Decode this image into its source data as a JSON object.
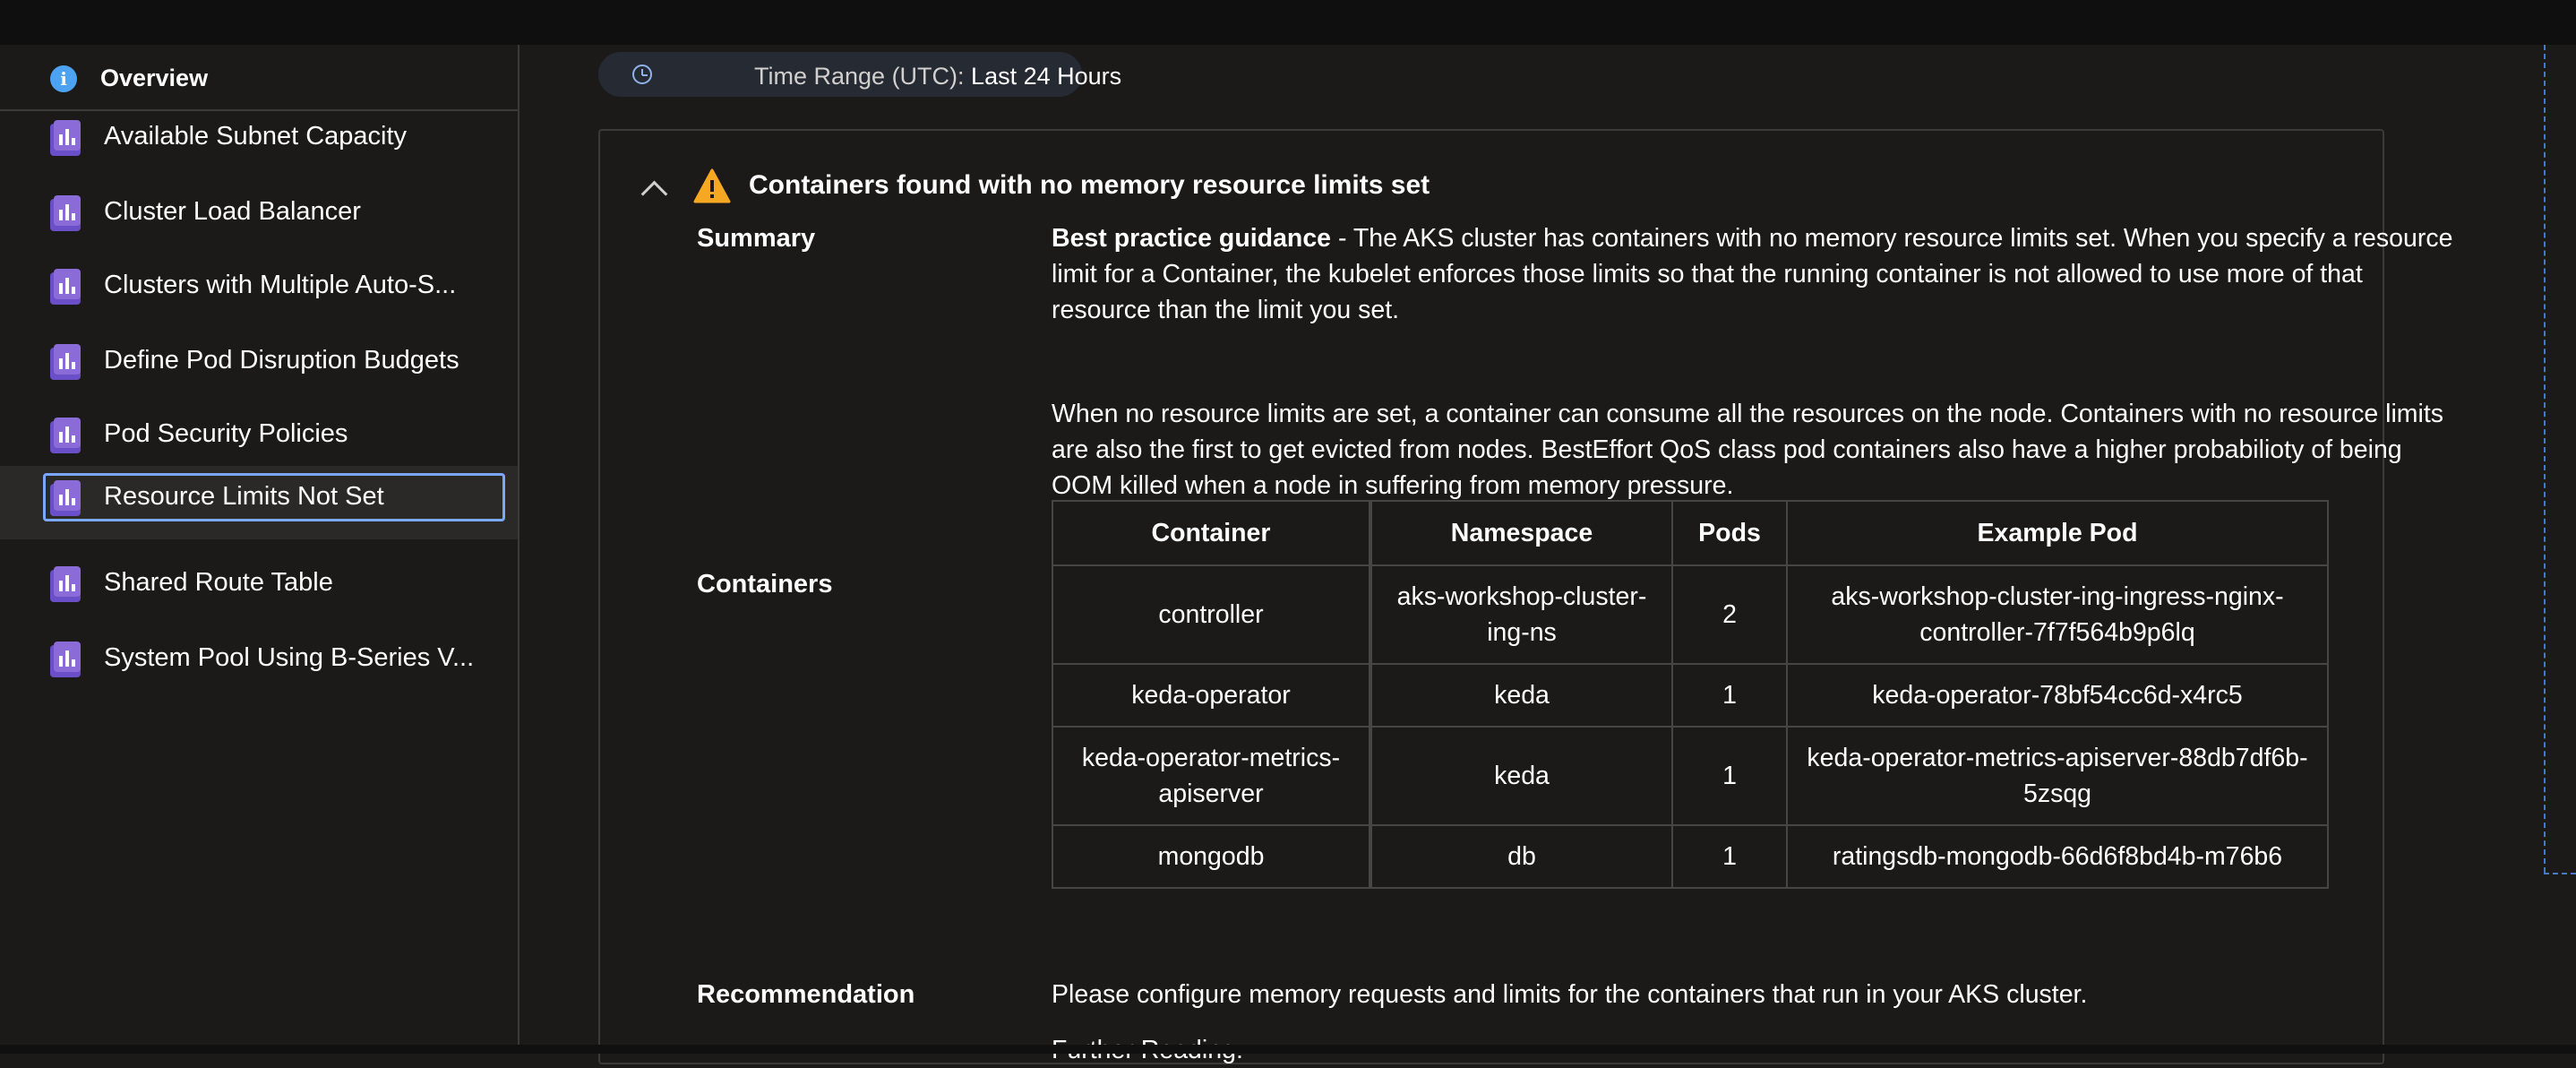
{
  "sidebar": {
    "overview_label": "Overview",
    "items": [
      {
        "label": "Available Subnet Capacity"
      },
      {
        "label": "Cluster Load Balancer"
      },
      {
        "label": "Clusters with Multiple Auto-S..."
      },
      {
        "label": "Define Pod Disruption Budgets"
      },
      {
        "label": "Pod Security Policies"
      },
      {
        "label": "Resource Limits Not Set",
        "selected": true
      },
      {
        "label": "Shared Route Table"
      },
      {
        "label": "System Pool Using B-Series V..."
      }
    ]
  },
  "time_range": {
    "label": "Time Range (UTC): ",
    "value": "Last 24 Hours"
  },
  "card": {
    "title": "Containers found with no memory resource limits set",
    "summary_label": "Summary",
    "summary_bold": "Best practice guidance",
    "summary_text": " - The AKS cluster has containers with no memory resource limits set. When you specify a resource limit for a Container, the kubelet enforces those limits so that the running container is not allowed to use more of that resource than the limit you set.",
    "summary_text_2": "When no resource limits are set, a container can consume all the resources on the node. Containers with no resource limits are also the first to get evicted from nodes. BestEffort QoS class pod containers also have a higher probabilioty of being OOM killed when a node in suffering from memory pressure.",
    "containers_label": "Containers",
    "table": {
      "headers": [
        "Container",
        "Namespace",
        "Pods",
        "Example Pod"
      ],
      "rows": [
        [
          "controller",
          "aks-workshop-cluster-ing-ns",
          "2",
          "aks-workshop-cluster-ing-ingress-nginx-controller-7f7f564b9p6lq"
        ],
        [
          "keda-operator",
          "keda",
          "1",
          "keda-operator-78bf54cc6d-x4rc5"
        ],
        [
          "keda-operator-metrics-apiserver",
          "keda",
          "1",
          "keda-operator-metrics-apiserver-88db7df6b-5zsqg"
        ],
        [
          "mongodb",
          "db",
          "1",
          "ratingsdb-mongodb-66d6f8bd4b-m76b6"
        ]
      ]
    },
    "recommendation_label": "Recommendation",
    "recommendation_text": "Please configure memory requests and limits for the containers that run in your AKS cluster.",
    "further_reading_label": "Further Reading:"
  },
  "colors": {
    "background": "#1b1a19",
    "accent_focus": "#7aa7ff",
    "warning": "#f7a823",
    "info": "#4ea3f0",
    "workbook_icon": "#8a6bd8"
  },
  "icons": {
    "overview": "info-icon",
    "nav_item": "workbook-icon",
    "time": "clock-icon",
    "collapse": "chevron-up-icon",
    "severity": "warning-icon"
  }
}
